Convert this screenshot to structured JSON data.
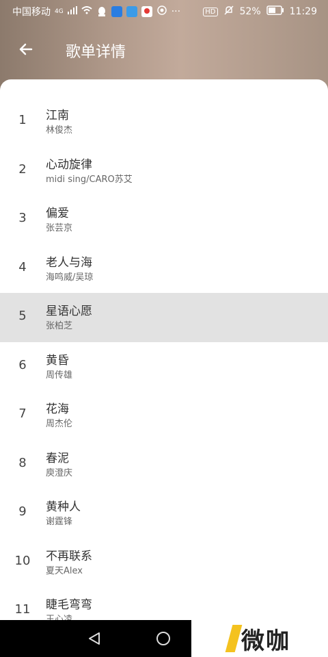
{
  "status_bar": {
    "carrier": "中国移动",
    "network": "4G",
    "battery": "52%",
    "time": "11:29",
    "hd": "HD",
    "more": "···"
  },
  "header": {
    "title": "歌单详情"
  },
  "songs": [
    {
      "index": "1",
      "title": "江南",
      "artist": "林俊杰"
    },
    {
      "index": "2",
      "title": "心动旋律",
      "artist": "midi sing/CARO苏艾"
    },
    {
      "index": "3",
      "title": "偏爱",
      "artist": "张芸京"
    },
    {
      "index": "4",
      "title": "老人与海",
      "artist": "海鸣威/吴琼"
    },
    {
      "index": "5",
      "title": "星语心愿",
      "artist": "张柏芝"
    },
    {
      "index": "6",
      "title": "黄昏",
      "artist": "周传雄"
    },
    {
      "index": "7",
      "title": "花海",
      "artist": "周杰伦"
    },
    {
      "index": "8",
      "title": "春泥",
      "artist": "庾澄庆"
    },
    {
      "index": "9",
      "title": "黄种人",
      "artist": "谢霆锋"
    },
    {
      "index": "10",
      "title": "不再联系",
      "artist": "夏天Alex"
    },
    {
      "index": "11",
      "title": "睫毛弯弯",
      "artist": "王心凌"
    }
  ],
  "watermark": {
    "text": "微咖"
  },
  "colors": {
    "header": "#b19a8b",
    "selected_row": "#e2e2e2"
  }
}
